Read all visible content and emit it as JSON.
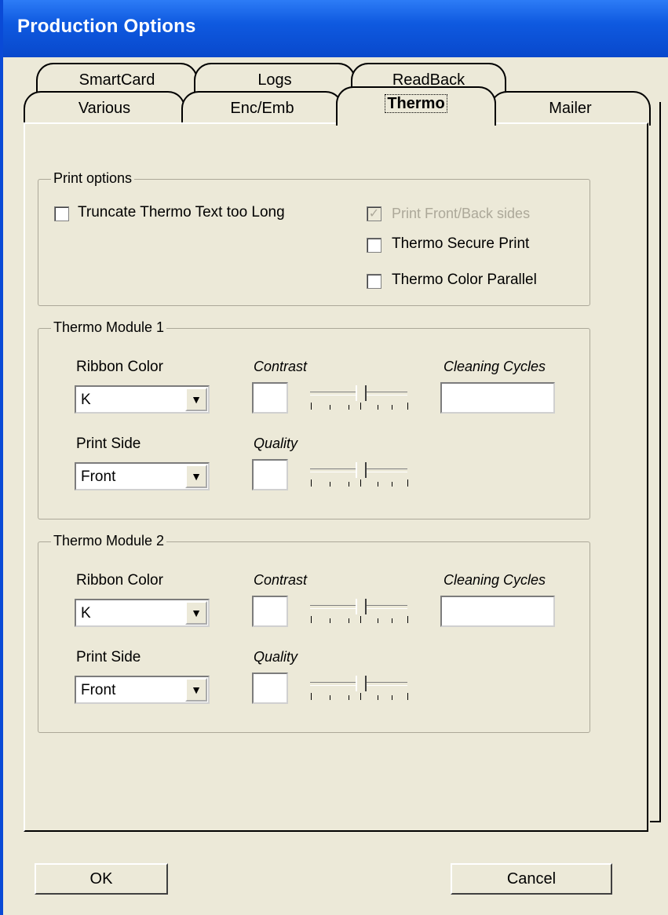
{
  "window": {
    "title": "Production Options"
  },
  "tabs": {
    "row_back": [
      "SmartCard",
      "Logs",
      "ReadBack"
    ],
    "row_front": [
      "Various",
      "Enc/Emb",
      "Thermo",
      "Mailer"
    ],
    "active": "Thermo"
  },
  "print_options": {
    "legend": "Print options",
    "truncate": {
      "label": "Truncate Thermo Text too Long",
      "checked": false
    },
    "front_back": {
      "label": "Print Front/Back sides",
      "checked": true,
      "enabled": false
    },
    "secure": {
      "label": "Thermo Secure Print",
      "checked": false
    },
    "parallel": {
      "label": "Thermo Color Parallel",
      "checked": false
    }
  },
  "module1": {
    "legend": "Thermo Module 1",
    "ribbon_label": "Ribbon Color",
    "ribbon_value": "K",
    "side_label": "Print Side",
    "side_value": "Front",
    "contrast_label": "Contrast",
    "quality_label": "Quality",
    "cleaning_label": "Cleaning Cycles",
    "contrast_value": "",
    "quality_value": "",
    "cleaning_value": ""
  },
  "module2": {
    "legend": "Thermo Module 2",
    "ribbon_label": "Ribbon Color",
    "ribbon_value": "K",
    "side_label": "Print Side",
    "side_value": "Front",
    "contrast_label": "Contrast",
    "quality_label": "Quality",
    "cleaning_label": "Cleaning Cycles",
    "contrast_value": "",
    "quality_value": "",
    "cleaning_value": ""
  },
  "buttons": {
    "ok": "OK",
    "cancel": "Cancel"
  },
  "icons": {
    "dropdown": "chevron-down-icon",
    "check": "checkmark-icon"
  },
  "colors": {
    "titlebar": "#0848cc",
    "face": "#ece9d8"
  }
}
